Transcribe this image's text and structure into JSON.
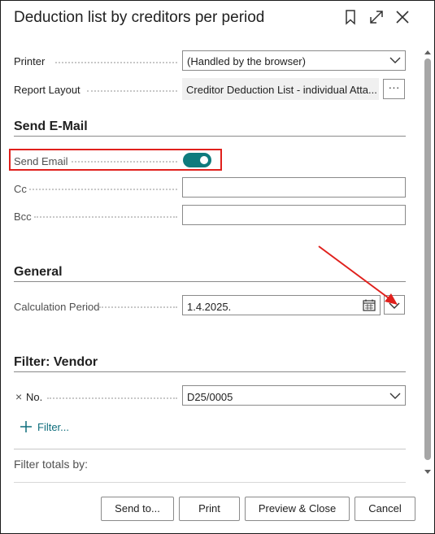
{
  "dialog": {
    "title": "Deduction list by creditors per period"
  },
  "options": {
    "printer_label": "Printer",
    "printer_value": "(Handled by the browser)",
    "report_layout_label": "Report Layout",
    "report_layout_value": "Creditor Deduction List - individual Atta...",
    "more_options": "···"
  },
  "send_email_section": {
    "heading": "Send E-Mail",
    "send_email_label": "Send Email",
    "send_email_enabled": true,
    "cc_label": "Cc",
    "cc_value": "",
    "bcc_label": "Bcc",
    "bcc_value": ""
  },
  "general_section": {
    "heading": "General",
    "calculation_period_label": "Calculation Period",
    "calculation_period_value": "1.4.2025."
  },
  "filter_section": {
    "heading": "Filter: Vendor",
    "remove_glyph": "×",
    "no_label": "No.",
    "no_value": "D25/0005",
    "add_filter_label": "Filter...",
    "filter_totals_label": "Filter totals by:"
  },
  "footer": {
    "send_to": "Send to...",
    "print": "Print",
    "preview_close": "Preview & Close",
    "cancel": "Cancel"
  },
  "colors": {
    "accent": "#0f7b7d",
    "highlight": "#e0201c",
    "annotation_arrow": "#e0201c"
  }
}
